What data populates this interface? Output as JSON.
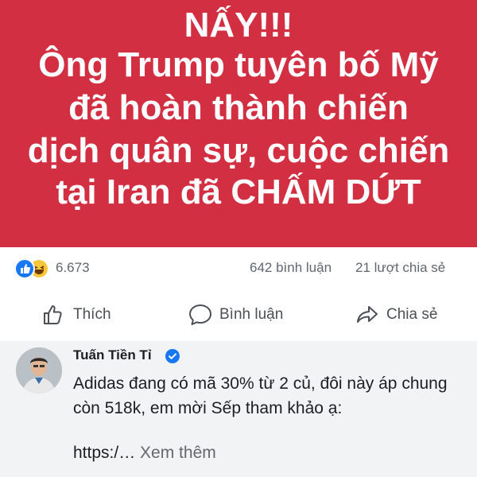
{
  "post": {
    "banner_lines": [
      "NẤY!!!",
      "Ông Trump tuyên bố Mỹ",
      "đã hoàn thành chiến",
      "dịch quân sự, cuộc chiến",
      "tại Iran đã CHẤM DỨT"
    ],
    "banner_color": "#d32f42",
    "stats": {
      "reaction_count": "6.673",
      "reaction_icons": [
        "like-icon",
        "haha-icon"
      ],
      "comments": "642 bình luận",
      "shares": "21 lượt chia sẻ"
    },
    "actions": [
      {
        "label": "Thích",
        "icon": "thumbs-up-icon"
      },
      {
        "label": "Bình luận",
        "icon": "comment-bubble-icon"
      },
      {
        "label": "Chia sẻ",
        "icon": "share-arrow-icon"
      }
    ]
  },
  "comment": {
    "author": "Tuấn Tiền Tỉ",
    "verified_color": "#1877f2",
    "text": "Adidas đang có mã 30% từ 2 củ, đôi này áp chung còn 518k, em mời Sếp tham khảo ạ:",
    "link_text": "https:/…",
    "see_more": "Xem thêm"
  }
}
